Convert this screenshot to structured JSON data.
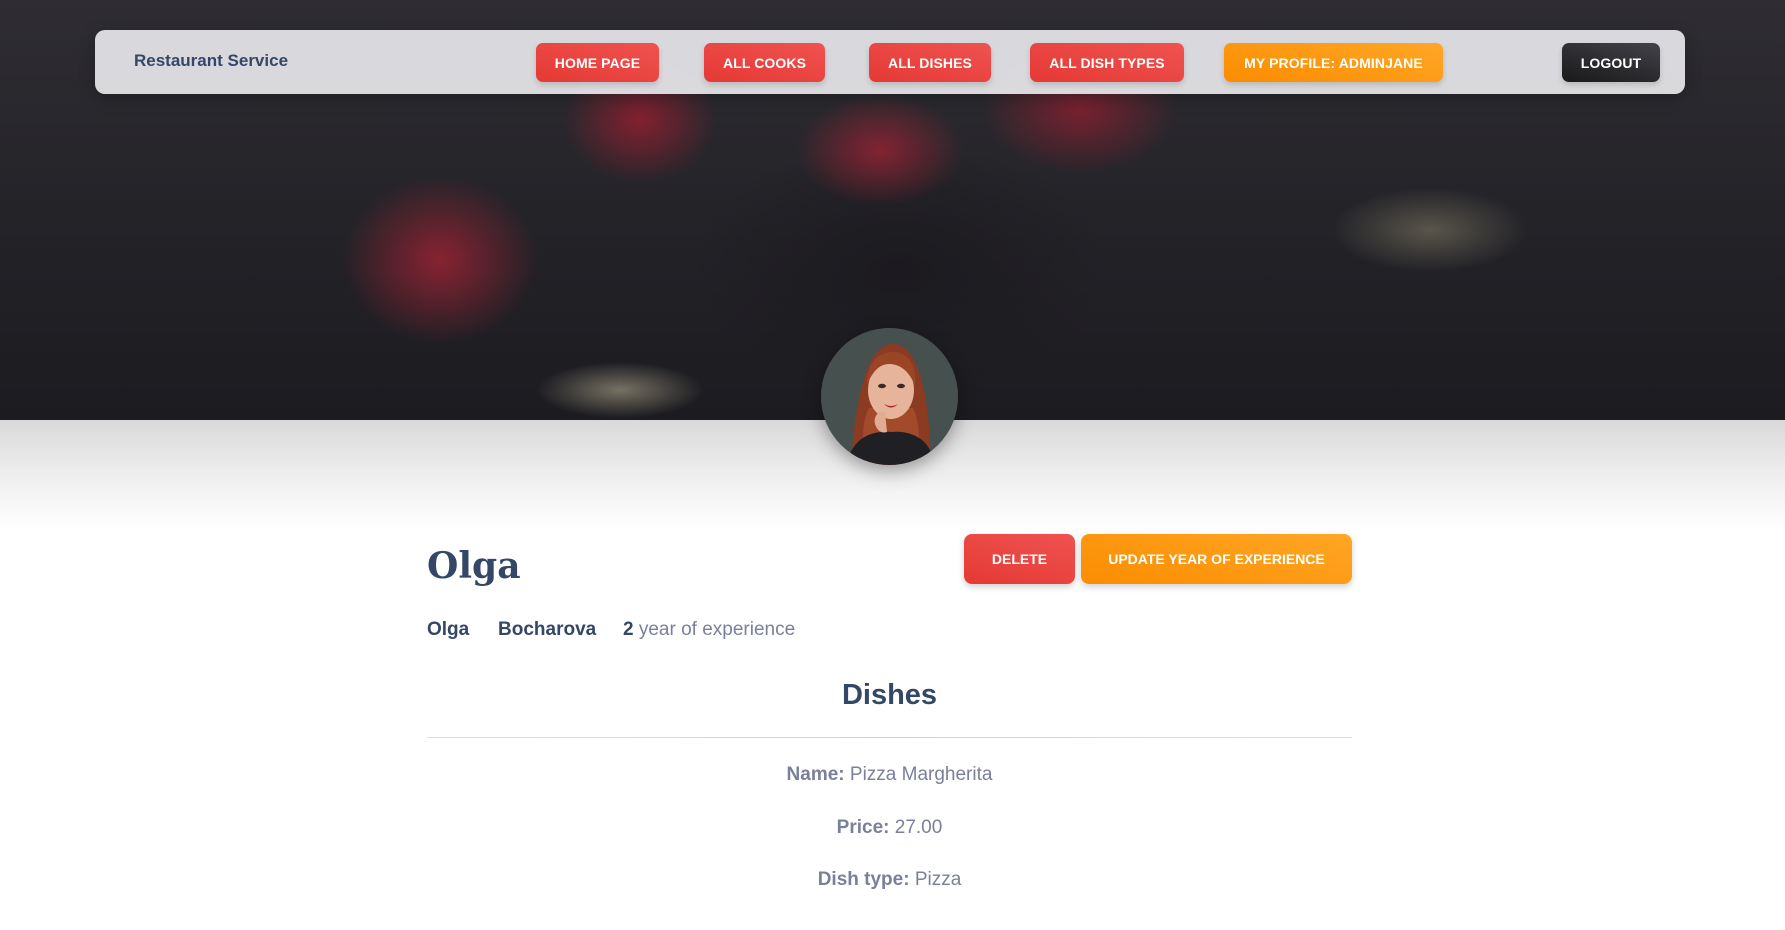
{
  "navbar": {
    "brand": "Restaurant Service",
    "items": [
      {
        "label": "HOME PAGE"
      },
      {
        "label": "ALL COOKS"
      },
      {
        "label": "ALL DISHES"
      },
      {
        "label": "ALL DISH TYPES"
      },
      {
        "label": "MY PROFILE: ADMINJANE"
      }
    ],
    "logout": "LOGOUT"
  },
  "profile": {
    "title": "Olga",
    "first_name": "Olga",
    "last_name": "Bocharova",
    "years": "2",
    "years_suffix": "year of experience",
    "avatar_icon": "user-avatar-photo"
  },
  "actions": {
    "delete": "DELETE",
    "update": "UPDATE YEAR OF EXPERIENCE"
  },
  "dishes": {
    "title": "Dishes",
    "items": [
      {
        "name_label": "Name:",
        "name": "Pizza Margherita",
        "price_label": "Price:",
        "price": "27.00",
        "type_label": "Dish type:",
        "type": "Pizza"
      }
    ]
  },
  "colors": {
    "primary_red": "#e53935",
    "accent_orange": "#fb8c00",
    "dark_button": "#191919",
    "text_dark": "#344767",
    "text_muted": "#7b809a"
  }
}
